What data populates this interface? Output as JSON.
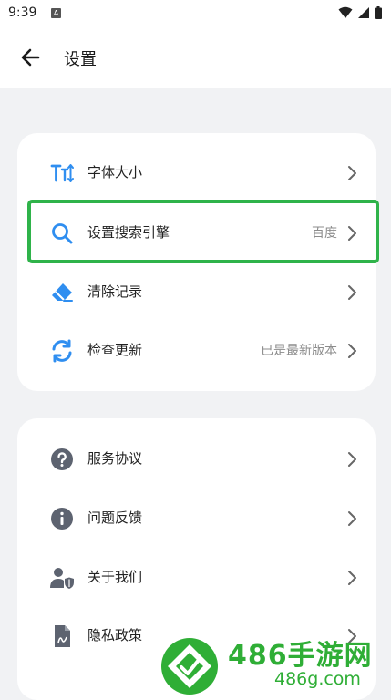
{
  "status_bar": {
    "time": "9:39",
    "notification_letter": "A"
  },
  "header": {
    "title": "设置"
  },
  "group1": [
    {
      "label": "字体大小",
      "value": "",
      "icon": "font-size-icon"
    },
    {
      "label": "设置搜索引擎",
      "value": "百度",
      "icon": "search-icon"
    },
    {
      "label": "清除记录",
      "value": "",
      "icon": "eraser-icon"
    },
    {
      "label": "检查更新",
      "value": "已是最新版本",
      "icon": "refresh-icon"
    }
  ],
  "group2": [
    {
      "label": "服务协议",
      "icon": "question-icon"
    },
    {
      "label": "问题反馈",
      "icon": "info-icon"
    },
    {
      "label": "关于我们",
      "icon": "user-shield-icon"
    },
    {
      "label": "隐私政策",
      "icon": "document-icon"
    }
  ],
  "watermark": {
    "text": "486手游网",
    "url": "486g.com"
  },
  "colors": {
    "accent_blue": "#2f8ef0",
    "highlight_green": "#2fb34a",
    "icon_gray": "#5d6370"
  }
}
